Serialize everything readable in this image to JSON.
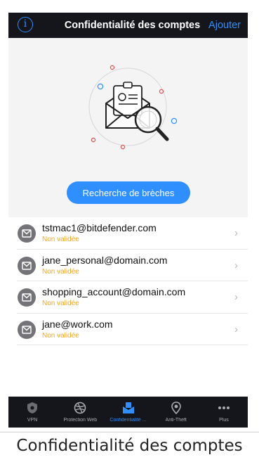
{
  "header": {
    "title": "Confidentialité des comptes",
    "add_label": "Ajouter",
    "info_glyph": "i"
  },
  "hero": {
    "search_button": "Recherche de brèches"
  },
  "accounts": [
    {
      "email": "tstmac1@bitdefender.com",
      "status": "Non validée"
    },
    {
      "email": "jane_personal@domain.com",
      "status": "Non validée"
    },
    {
      "email": "shopping_account@domain.com",
      "status": "Non validée"
    },
    {
      "email": "jane@work.com",
      "status": "Non validée"
    }
  ],
  "chevron": "›",
  "tabs": [
    {
      "label": "VPN",
      "icon": "vpn-shield-icon"
    },
    {
      "label": "Protection Web",
      "icon": "web-protection-icon"
    },
    {
      "label": "Confidentialité ...",
      "icon": "privacy-envelope-icon",
      "active": true
    },
    {
      "label": "Anti-Theft",
      "icon": "location-pin-icon"
    },
    {
      "label": "Plus",
      "icon": "more-dots-icon"
    }
  ],
  "caption": "Confidentialité des comptes",
  "colors": {
    "accent": "#2f8fff",
    "status": "#f5a623",
    "bar": "#14161c"
  }
}
